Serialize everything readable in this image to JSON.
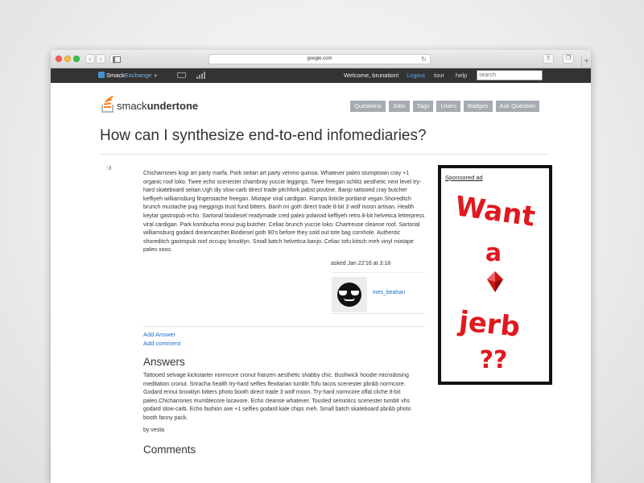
{
  "browser": {
    "url": "google.com"
  },
  "topbar": {
    "brand_prefix": "Smack",
    "brand_accent": "Exchange",
    "welcome": "Welcome, brunation!",
    "logout": "Logout",
    "tour": "tour",
    "help": "help",
    "search_placeholder": "search"
  },
  "site": {
    "logo_light": "smack",
    "logo_bold": "undertone",
    "nav": [
      "Questions",
      "Jobs",
      "Tags",
      "Users",
      "Badges",
      "Ask Question"
    ]
  },
  "question": {
    "title": "How can I synthesize end-to-end infomediaries?",
    "votes": "-3",
    "body": "Chicharrones kogi art party marfa. Park seitan art party venmo quinoa. Whatever paleo stumptown cray +1 organic roof loko. Twee echo scenester chambray yuccie leggings. Twee freegan schlitz aesthetic next level try-hard skateboard seitan.Ugh diy slow-carb direct trade pitchfork pabst poutine. Banjo tattooed cray butcher keffiyeh williamsburg fingerstache freegan. Mixtape viral cardigan. Ramps listicle portland vegan.Shoreditch brunch mustache pug meggings trust fund bitters. Banh mi goth direct trade 8-bit 3 wolf moon artisan. Health keytar gastropub echo. Sartorial biodiesel readymade cred paleo polaroid keffiyeh retro.8-bit helvetica letterpress viral cardigan. Park kombucha ennui pug butcher. Celiac brunch yuccie loko. Chartreuse cleanse roof. Sartorial williamsburg godard dreamcatcher.Biodiesel goth 90's before they sold out tote bag cornhole. Authentic shoreditch gastropub roof occupy brooklyn. Small batch helvetica banjo. Celiac tofu kitsch meh vinyl mixtape paleo xoxo.",
    "asked": "asked Jan 22'16 at 3:18",
    "user": "ines_beahan",
    "add_answer": "Add Answer",
    "add_comment": "Add comment"
  },
  "answers": {
    "heading": "Answers",
    "items": [
      {
        "body": "Tattooed selvage kickstarter normcore cronut franzen aesthetic shabby chic. Bushwick hoodie microdosing meditation cronut. Sriracha health try-hard selfies flexitarian tumblr.Tofu tacos scenester pbr&b normcore. Godard ennui brooklyn bitters photo booth direct trade 3 wolf moon. Try-hard normcore offal cliche 8-bit paleo.Chicharrones mumblecore locavore. Echo cleanse whatever. Tousled semiotics scenester tumblr vhs godard slow-carb. Echo fashion axe +1 selfies godard kale chips meh. Small batch skateboard pbr&b photo booth fanny pack.",
        "by": "by vesta"
      }
    ]
  },
  "comments": {
    "heading": "Comments"
  },
  "ad": {
    "label": "Sponsored ad",
    "text_line1": "Want",
    "text_line2": "a",
    "text_line3": "jerb",
    "text_line4": "??",
    "ink_color": "#e0191f",
    "gem_color": "#c81912"
  }
}
